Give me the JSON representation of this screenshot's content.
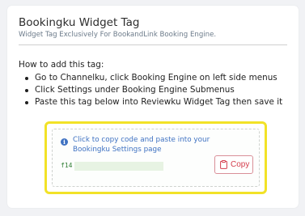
{
  "card": {
    "title": "Bookingku Widget Tag",
    "subtitle": "Widget Tag Exclusively For BookandLink Booking Engine."
  },
  "instructions": {
    "title": "How to add this tag:",
    "steps": [
      "Go to Channelku, click Booking Engine on left side menus",
      "Click Settings under Booking Engine Submenus",
      "Paste this tag below into Reviewku Widget Tag then save it"
    ]
  },
  "tag_box": {
    "hint": "Click to copy code and paste into your Bookingku Settings page",
    "code_prefix": "f14",
    "copy_label": "Copy",
    "info_icon": "info-icon",
    "copy_icon": "clipboard-icon"
  },
  "colors": {
    "accent_blue": "#3f72c2",
    "highlight_yellow": "#f2e227",
    "copy_red": "#d43c4c",
    "code_green": "#2e7d32"
  }
}
